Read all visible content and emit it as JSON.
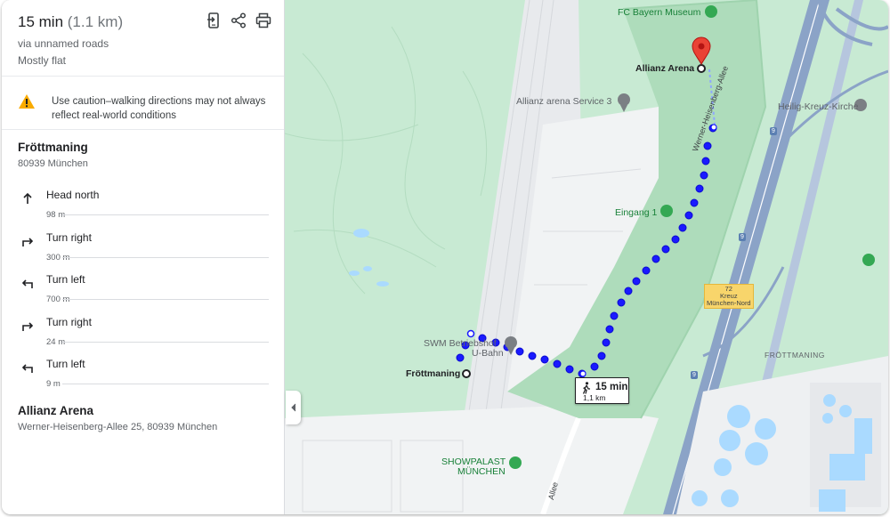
{
  "summary": {
    "time": "15 min",
    "distance": "(1.1 km)",
    "via": "via unnamed roads",
    "terrain": "Mostly flat"
  },
  "actions": {
    "send_icon": "send-to-phone-icon",
    "share_icon": "share-icon",
    "print_icon": "print-icon"
  },
  "warning": {
    "text": "Use caution–walking directions may not always reflect real-world conditions"
  },
  "start": {
    "name": "Fröttmaning",
    "address": "80939 München"
  },
  "steps": [
    {
      "label": "Head north",
      "distance": "98 m",
      "icon": "arrow-up-icon"
    },
    {
      "label": "Turn right",
      "distance": "300 m",
      "icon": "turn-right-icon"
    },
    {
      "label": "Turn left",
      "distance": "700 m",
      "icon": "turn-left-icon"
    },
    {
      "label": "Turn right",
      "distance": "24 m",
      "icon": "turn-right-icon"
    },
    {
      "label": "Turn left",
      "distance": "9 m",
      "icon": "turn-left-icon"
    }
  ],
  "end": {
    "name": "Allianz Arena",
    "address": "Werner-Heisenberg-Allee 25, 80939 München"
  },
  "map": {
    "labels": {
      "fc_bayern": "FC Bayern Museum",
      "allianz_arena": "Allianz Arena",
      "service3": "Allianz arena Service 3",
      "heilig_kreuz": "Heilig-Kreuz-Kirche",
      "eingang": "Eingang 1",
      "werner_allee": "Werner-Heisenberg-Allee",
      "swm_line1": "SWM Betriebshof",
      "swm_line2": "U-Bahn",
      "froettmaning_station": "Fröttmaning",
      "froettmaning_area": "FRÖTTMANING",
      "showpalast_1": "SHOWPALAST",
      "showpalast_2": "MÜNCHEN",
      "exit_number": "72",
      "exit_line1": "Kreuz",
      "exit_line2": "München-Nord",
      "shield_9": "9",
      "allee_bottom": "Allee"
    },
    "route_box": {
      "time": "15 min",
      "distance": "1,1 km"
    },
    "colors": {
      "park": "#c2e7cf",
      "arena_ground": "#aedcbb",
      "route": "#1a1aff",
      "highway": "#8ba3c7",
      "urban": "#f1f3f4",
      "water": "#aadaff"
    }
  }
}
